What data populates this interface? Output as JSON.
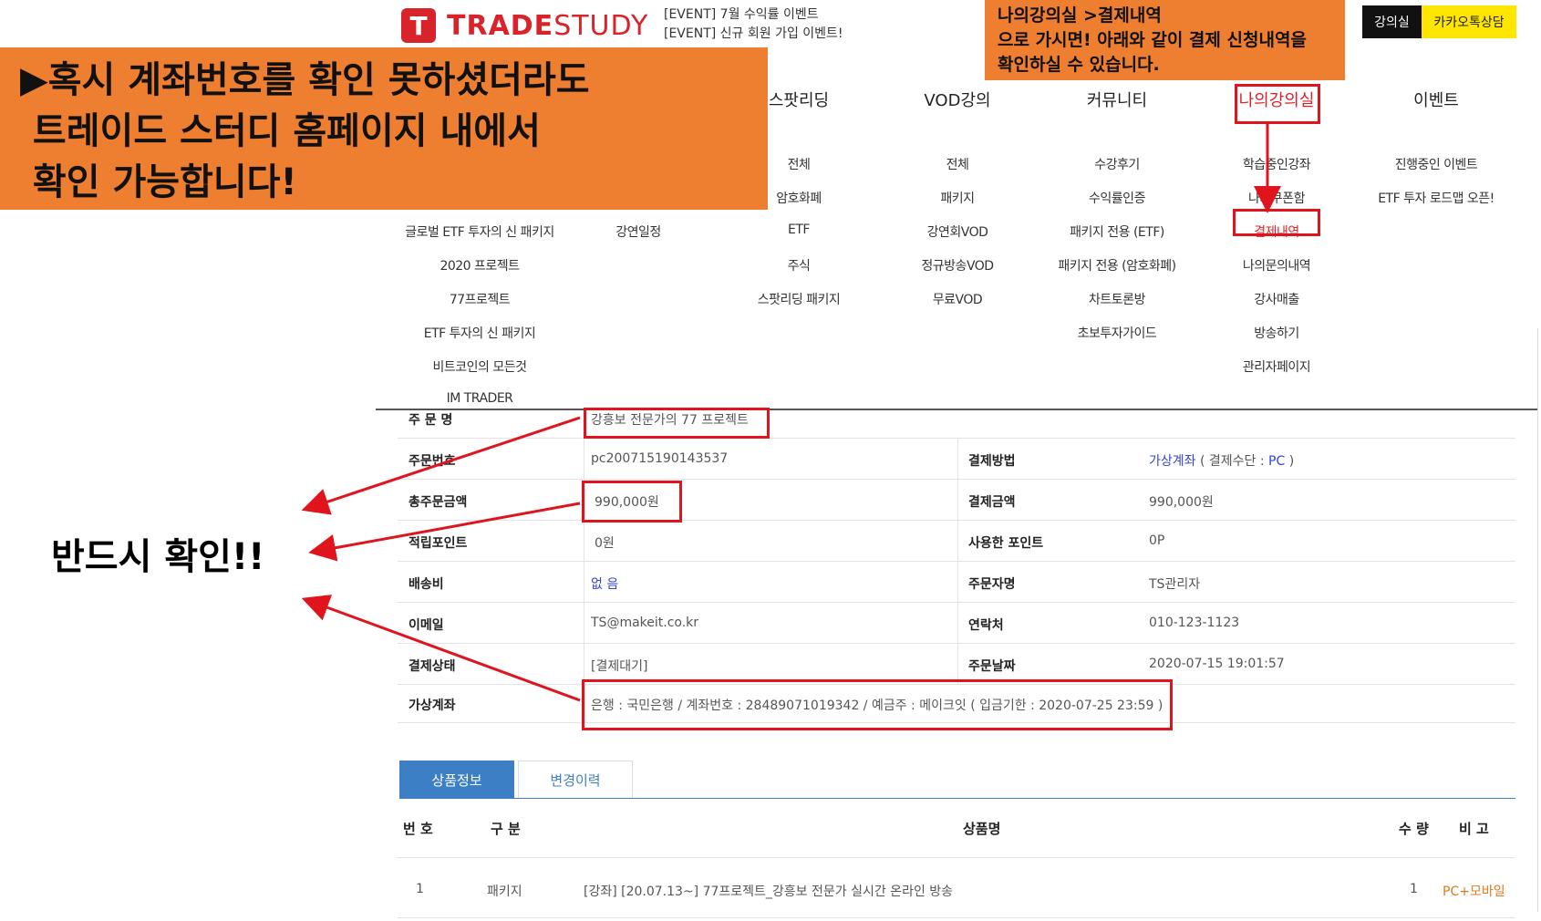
{
  "header": {
    "logo_mark": "T",
    "logo_trade": "TRADE",
    "logo_study": "STUDY",
    "events": [
      "[EVENT] 7월 수익률 이벤트",
      "[EVENT] 신규 회원 가입 이벤트!"
    ],
    "btn_myclass": "강의실",
    "btn_kakao": "카카오톡상담"
  },
  "menu": {
    "col1_items": [
      "글로벌 ETF 투자의 신 패키지",
      "2020 프로젝트",
      "77프로젝트",
      "ETF 투자의 신 패키지",
      "비트코인의 모든것",
      "IM TRADER"
    ],
    "col2_items": [
      "강연일정"
    ],
    "col3": {
      "head": "스팟리딩",
      "items": [
        "전체",
        "암호화폐",
        "ETF",
        "주식",
        "스팟리딩 패키지"
      ]
    },
    "col4": {
      "head": "VOD강의",
      "items": [
        "전체",
        "패키지",
        "강연회VOD",
        "정규방송VOD",
        "무료VOD"
      ]
    },
    "col5": {
      "head": "커뮤니티",
      "items": [
        "수강후기",
        "수익률인증",
        "패키지 전용 (ETF)",
        "패키지 전용 (암호화폐)",
        "차트토론방",
        "초보투자가이드"
      ]
    },
    "col6": {
      "head": "나의강의실",
      "items": [
        "학습중인강좌",
        "나의쿠폰함",
        "결제내역",
        "나의문의내역",
        "강사매출",
        "방송하기",
        "관리자페이지"
      ]
    },
    "col7": {
      "head": "이벤트",
      "items": [
        "진행중인 이벤트",
        "ETF 투자 로드맵 오픈!"
      ]
    }
  },
  "order": {
    "name_label": "주 문 명",
    "name_value": "강흥보 전문가의 77 프로젝트",
    "rows": [
      {
        "l1": "주문번호",
        "v1": "pc200715190143537",
        "l2": "결제방법",
        "v2a": "가상계좌",
        "v2b": " ( 결제수단 : ",
        "v2c": "PC",
        "v2d": " )"
      },
      {
        "l1": "총주문금액",
        "v1": "990,000원",
        "l2": "결제금액",
        "v2": "990,000원"
      },
      {
        "l1": "적립포인트",
        "v1": "0원",
        "l2": "사용한 포인트",
        "v2": "0P"
      },
      {
        "l1": "배송비",
        "v1": "없 음",
        "l2": "주문자명",
        "v2": "TS관리자"
      },
      {
        "l1": "이메일",
        "v1": "TS@makeit.co.kr",
        "l2": "연락처",
        "v2": "010-123-1123"
      },
      {
        "l1": "결제상태",
        "v1": "[결제대기]",
        "l2": "주문날짜",
        "v2": "2020-07-15 19:01:57"
      }
    ],
    "vaccount_label": "가상계좌",
    "vaccount_value": "은행 : 국민은행 / 계좌번호 : 28489071019342 / 예금주 : 메이크잇 ( 입금기한 : 2020-07-25 23:59 )"
  },
  "tabs": {
    "active": "상품정보",
    "idle": "변경이력"
  },
  "product_table": {
    "headers": [
      "번 호",
      "구 분",
      "상품명",
      "수 량",
      "비 고"
    ],
    "row": [
      "1",
      "패키지",
      "[강좌] [20.07.13~] 77프로젝트_강흥보 전문가 실시간 온라인 방송",
      "1",
      "PC+모바일"
    ]
  },
  "annotations": {
    "left_callout": "▶혹시 계좌번호를 확인 못하셨더라도\n 트레이드 스터디 홈페이지 내에서\n 확인 가능합니다!",
    "top_callout": "나의강의실 >결제내역\n으로 가시면! 아래와 같이 결제 신청내역을\n확인하실 수 있습니다.",
    "must_check": "반드시 확인!!"
  },
  "colors": {
    "brand_red": "#d8232a",
    "callout_orange": "#ee7e30",
    "tab_blue": "#3d7fc4",
    "highlight_red": "#e0141c"
  }
}
